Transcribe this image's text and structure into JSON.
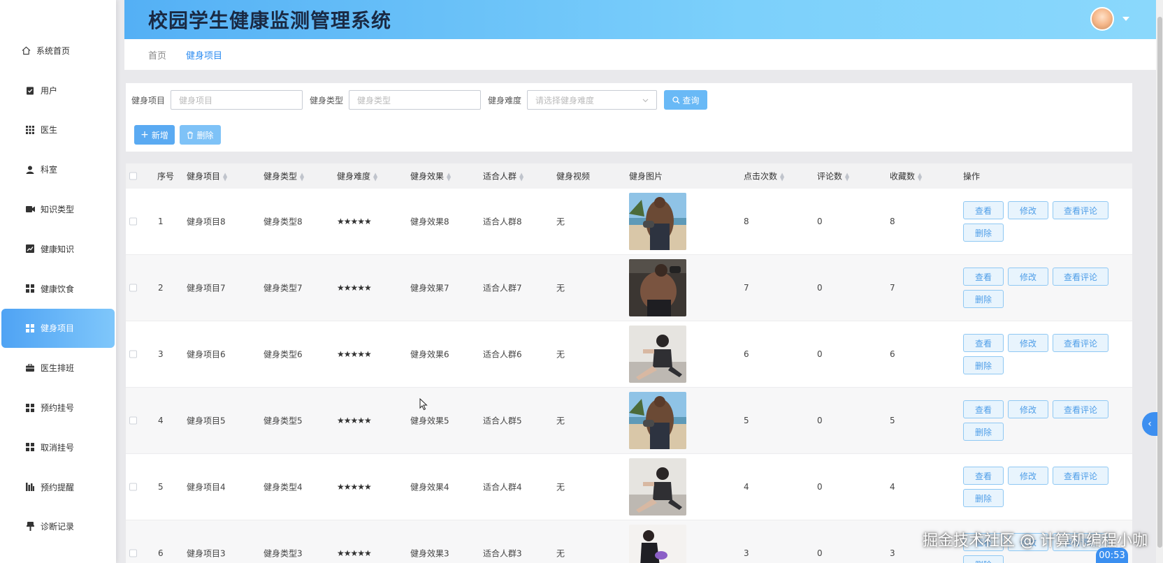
{
  "app": {
    "title": "校园学生健康监测管理系统"
  },
  "sidebar": {
    "items": [
      {
        "label": "系统首页",
        "icon": "home-icon"
      },
      {
        "label": "用户",
        "icon": "clipboard-icon"
      },
      {
        "label": "医生",
        "icon": "grid-icon"
      },
      {
        "label": "科室",
        "icon": "person-icon"
      },
      {
        "label": "知识类型",
        "icon": "video-icon"
      },
      {
        "label": "健康知识",
        "icon": "chart-icon"
      },
      {
        "label": "健康饮食",
        "icon": "tiles-icon"
      },
      {
        "label": "健身项目",
        "icon": "tiles-icon",
        "active": true
      },
      {
        "label": "医生排班",
        "icon": "briefcase-icon"
      },
      {
        "label": "预约挂号",
        "icon": "tiles-icon"
      },
      {
        "label": "取消挂号",
        "icon": "tiles-icon"
      },
      {
        "label": "预约提醒",
        "icon": "bars-icon"
      },
      {
        "label": "诊断记录",
        "icon": "pin-icon"
      }
    ]
  },
  "breadcrumb": {
    "home": "首页",
    "current": "健身项目"
  },
  "search": {
    "project_label": "健身项目",
    "project_placeholder": "健身项目",
    "type_label": "健身类型",
    "type_placeholder": "健身类型",
    "difficulty_label": "健身难度",
    "difficulty_placeholder": "请选择健身难度",
    "query_button": "查询"
  },
  "actions": {
    "add": "新增",
    "delete": "删除"
  },
  "table": {
    "headers": {
      "index": "序号",
      "project": "健身项目",
      "type": "健身类型",
      "difficulty": "健身难度",
      "effect": "健身效果",
      "crowd": "适合人群",
      "video": "健身视频",
      "image": "健身图片",
      "clicks": "点击次数",
      "comments": "评论数",
      "favorites": "收藏数",
      "ops": "操作"
    },
    "op_labels": {
      "view": "查看",
      "edit": "修改",
      "view_comments": "查看评论",
      "delete": "删除"
    },
    "rows": [
      {
        "index": "1",
        "project": "健身项目8",
        "type": "健身类型8",
        "difficulty": "★★★★★",
        "effect": "健身效果8",
        "crowd": "适合人群8",
        "video": "无",
        "image_icon": "man-beach-photo",
        "clicks": "8",
        "comments": "0",
        "favorites": "8"
      },
      {
        "index": "2",
        "project": "健身项目7",
        "type": "健身类型7",
        "difficulty": "★★★★★",
        "effect": "健身效果7",
        "crowd": "适合人群7",
        "video": "无",
        "image_icon": "man-gym-photo",
        "clicks": "7",
        "comments": "0",
        "favorites": "7"
      },
      {
        "index": "3",
        "project": "健身项目6",
        "type": "健身类型6",
        "difficulty": "★★★★★",
        "effect": "健身效果6",
        "crowd": "适合人群6",
        "video": "无",
        "image_icon": "woman-floor-photo",
        "clicks": "6",
        "comments": "0",
        "favorites": "6"
      },
      {
        "index": "4",
        "project": "健身项目5",
        "type": "健身类型5",
        "difficulty": "★★★★★",
        "effect": "健身效果5",
        "crowd": "适合人群5",
        "video": "无",
        "image_icon": "man-beach-photo",
        "clicks": "5",
        "comments": "0",
        "favorites": "5"
      },
      {
        "index": "5",
        "project": "健身项目4",
        "type": "健身类型4",
        "difficulty": "★★★★★",
        "effect": "健身效果4",
        "crowd": "适合人群4",
        "video": "无",
        "image_icon": "woman-floor-photo",
        "clicks": "4",
        "comments": "0",
        "favorites": "4"
      },
      {
        "index": "6",
        "project": "健身项目3",
        "type": "健身类型3",
        "difficulty": "★★★★★",
        "effect": "健身效果3",
        "crowd": "适合人群3",
        "video": "无",
        "image_icon": "woman-yoga-photo",
        "clicks": "3",
        "comments": "0",
        "favorites": "3"
      }
    ]
  },
  "overlay": {
    "watermark": "掘金技术社区 @ 计算机编程小咖",
    "timer": "00:53"
  },
  "colors": {
    "accent": "#4fa3f4",
    "header_start": "#54b0f5",
    "header_end": "#8ad8fc"
  }
}
